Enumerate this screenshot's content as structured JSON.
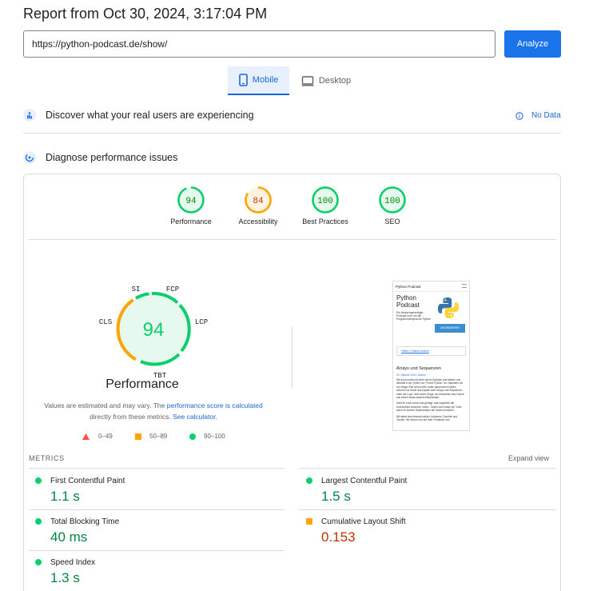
{
  "report_title": "Report from Oct 30, 2024, 3:17:04 PM",
  "url_value": "https://python-podcast.de/show/",
  "analyze_label": "Analyze",
  "tabs": [
    {
      "label": "Mobile"
    },
    {
      "label": "Desktop"
    }
  ],
  "field_data": {
    "heading": "Discover what your real users are experiencing",
    "no_data": "No Data"
  },
  "diagnose": {
    "heading": "Diagnose performance issues"
  },
  "scores": [
    {
      "value": "94",
      "label": "Performance",
      "status": "pass"
    },
    {
      "value": "84",
      "label": "Accessibility",
      "status": "average"
    },
    {
      "value": "100",
      "label": "Best Practices",
      "status": "pass"
    },
    {
      "value": "100",
      "label": "SEO",
      "status": "pass"
    }
  ],
  "big_gauge": {
    "value": "94",
    "label": "Performance",
    "segments": {
      "si": "SI",
      "fcp": "FCP",
      "lcp": "LCP",
      "tbt": "TBT",
      "cls": "CLS"
    }
  },
  "estimate_note": {
    "prefix": "Values are estimated and may vary. The ",
    "link1": "performance score is calculated",
    "middle": "directly from these metrics. ",
    "link2": "See calculator."
  },
  "legend": [
    {
      "range": "0–49"
    },
    {
      "range": "50–89"
    },
    {
      "range": "90–100"
    }
  ],
  "metrics_heading": "METRICS",
  "expand_view": "Expand view",
  "metrics": {
    "fcp": {
      "label": "First Contentful Paint",
      "value": "1.1 s"
    },
    "lcp": {
      "label": "Largest Contentful Paint",
      "value": "1.5 s"
    },
    "tbt": {
      "label": "Total Blocking Time",
      "value": "40 ms"
    },
    "cls": {
      "label": "Cumulative Layout Shift",
      "value": "0.153"
    },
    "si": {
      "label": "Speed Index",
      "value": "1.3 s"
    }
  },
  "screenshot": {
    "site_name": "Python Podcast",
    "heading": "Python Podcast",
    "intro": "Ein deutschsprachiger Podcast rund um die Programmiersprache Python",
    "subscribe": "ABONNIEREN",
    "filter": "Filters / Fulltext-Search",
    "episode_title": "Arrays und Sequenzen",
    "date": "30. Oktober 2024, Jochen",
    "para1": "Wir sind zurück mit einer neuen Episode und blicken uns diesmal in der Tiefen von \"Fluent Python\" an. Nachdem wir vor einiger Zeit schon über Listen gesprochen haben, nehmen wir heute das Kapitel über Arrays und Sequenzen unter die Lupe. Aber keine Sorge, wir betrachten das Ganze aus einem etwas anderen Blickwinkel.",
    "para2": "Habt ihr euch schon mal gefragt, was eigentlich der Unterschied zwischen Listen, Tupeln und Arrays ist? Oder wann ihr welche Datenstruktur am besten einsetzt?",
    "para3": "Mit dabei sind diesmal wieder Johannes, Dominik und Jochen. Wir freuen uns auf euer Feedback und"
  },
  "colors": {
    "pass": "#0cce6b",
    "average": "#ffa400",
    "fail": "#ff4e42",
    "accent": "#1a73e8"
  }
}
